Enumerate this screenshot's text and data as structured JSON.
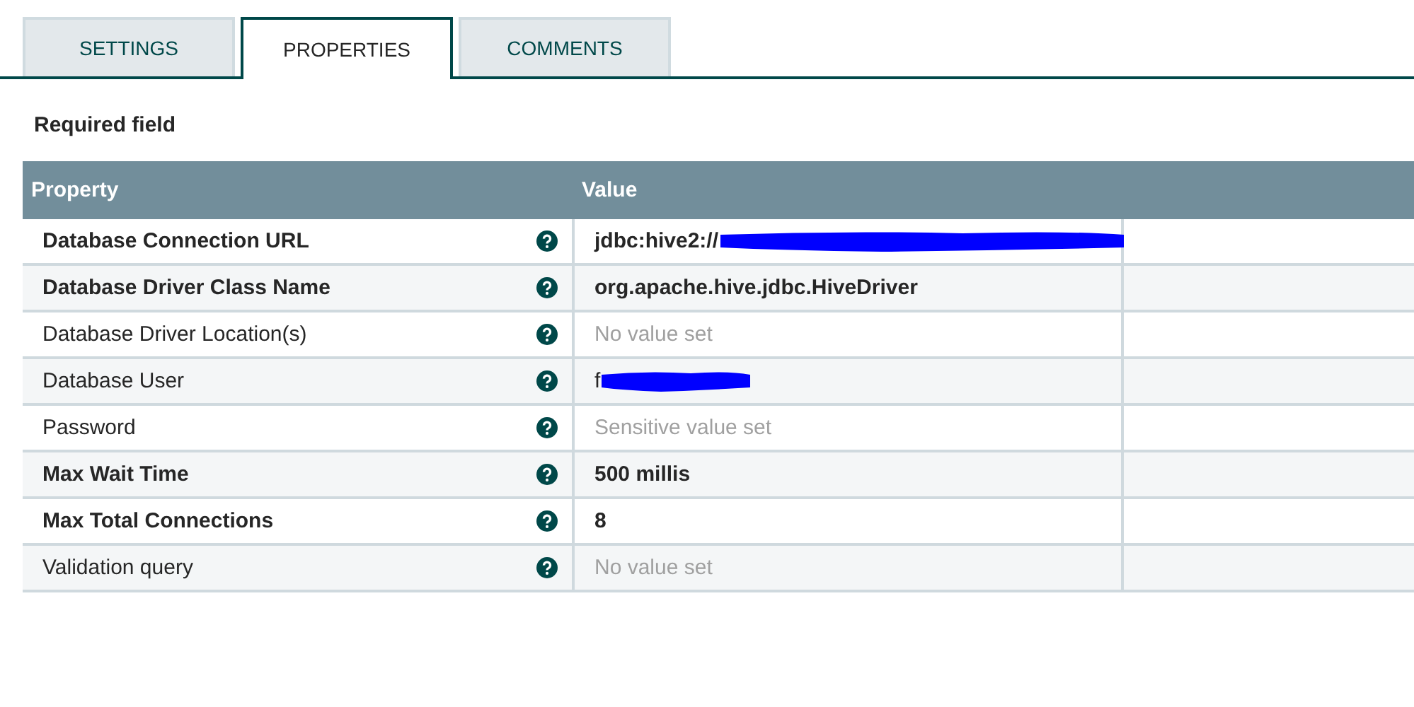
{
  "tabs": [
    {
      "label": "SETTINGS",
      "selected": false
    },
    {
      "label": "PROPERTIES",
      "selected": true
    },
    {
      "label": "COMMENTS",
      "selected": false
    }
  ],
  "required_note": "Required field",
  "table": {
    "columns": [
      "Property",
      "Value"
    ],
    "rows": [
      {
        "property": "Database Connection URL",
        "required": true,
        "value": "jdbc:hive2://",
        "kind": "set",
        "redacted": true
      },
      {
        "property": "Database Driver Class Name",
        "required": true,
        "value": "org.apache.hive.jdbc.HiveDriver",
        "kind": "set",
        "redacted": false
      },
      {
        "property": "Database Driver Location(s)",
        "required": false,
        "value": "No value set",
        "kind": "unset",
        "redacted": false
      },
      {
        "property": "Database User",
        "required": false,
        "value": "f",
        "kind": "set_plain",
        "redacted": true
      },
      {
        "property": "Password",
        "required": false,
        "value": "Sensitive value set",
        "kind": "unset",
        "redacted": false
      },
      {
        "property": "Max Wait Time",
        "required": true,
        "value": "500 millis",
        "kind": "set",
        "redacted": false
      },
      {
        "property": "Max Total Connections",
        "required": true,
        "value": "8",
        "kind": "set",
        "redacted": false
      },
      {
        "property": "Validation query",
        "required": false,
        "value": "No value set",
        "kind": "unset",
        "redacted": false
      }
    ]
  }
}
